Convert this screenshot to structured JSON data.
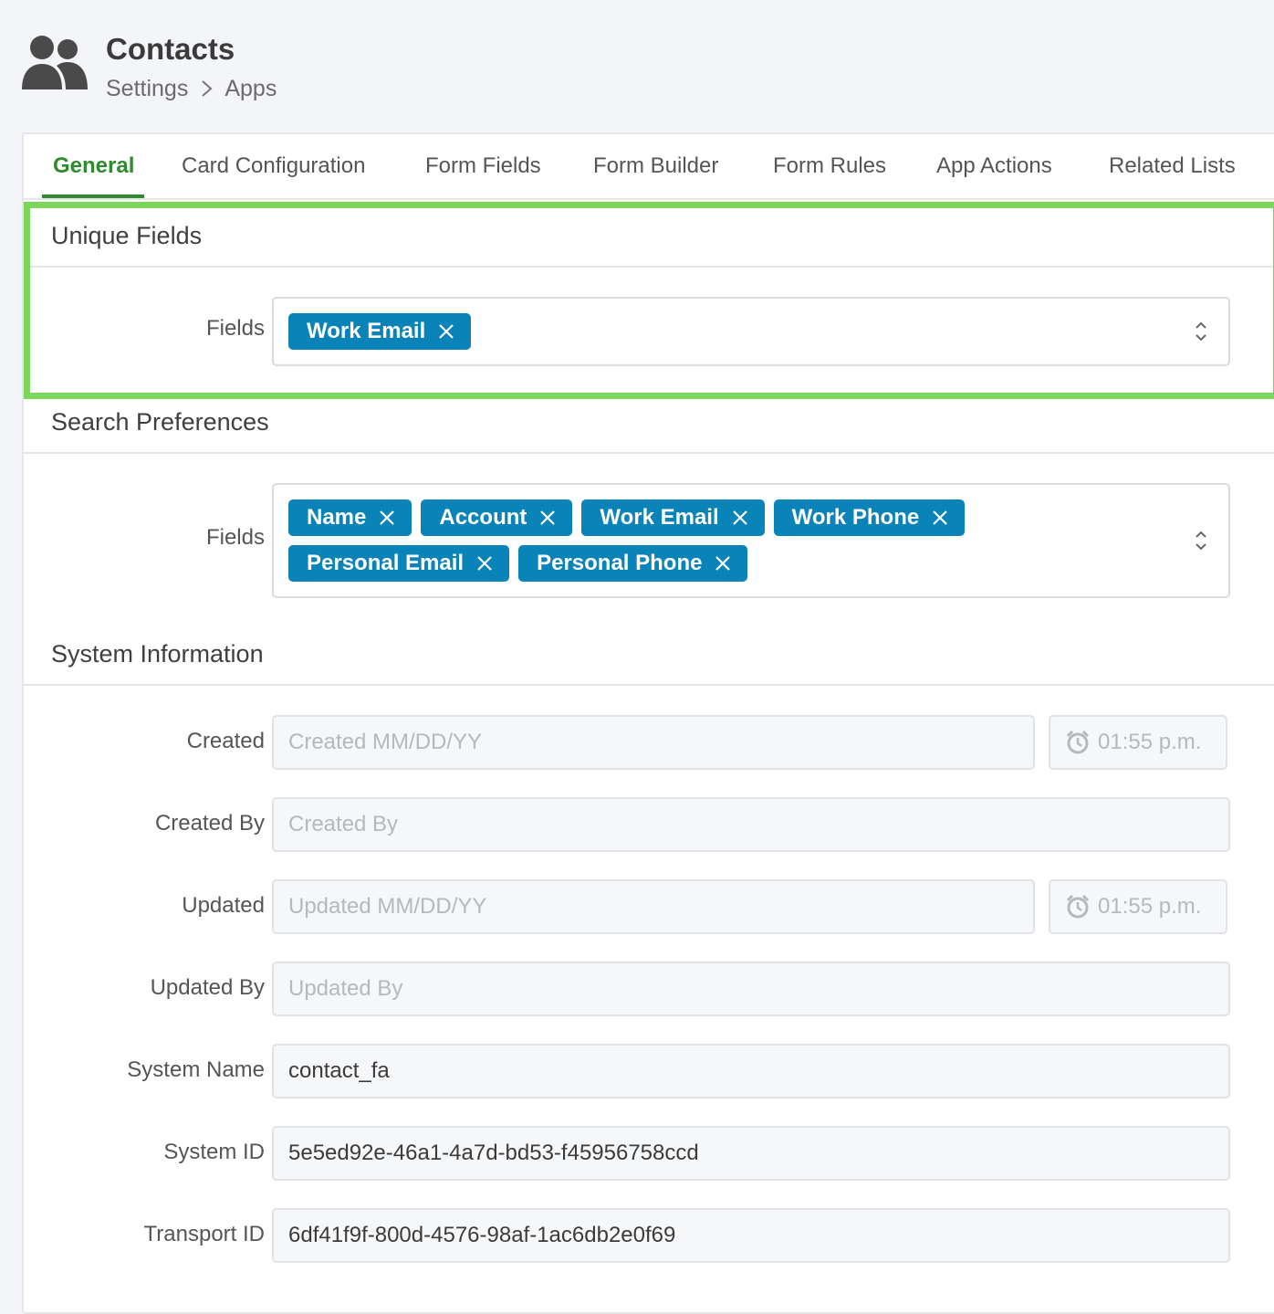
{
  "header": {
    "icon": "contacts-icon",
    "title": "Contacts",
    "breadcrumb": [
      "Settings",
      "Apps"
    ]
  },
  "tabs": [
    {
      "label": "General",
      "active": true
    },
    {
      "label": "Card Configuration"
    },
    {
      "label": "Form Fields"
    },
    {
      "label": "Form Builder"
    },
    {
      "label": "Form Rules"
    },
    {
      "label": "App Actions"
    },
    {
      "label": "Related Lists"
    }
  ],
  "colors": {
    "accent": "#2e8b2e",
    "chip": "#0a84b8",
    "highlight": "#7cd65b"
  },
  "unique_fields": {
    "title": "Unique Fields",
    "label": "Fields",
    "selected": [
      "Work Email"
    ]
  },
  "search_preferences": {
    "title": "Search Preferences",
    "label": "Fields",
    "selected": [
      "Name",
      "Account",
      "Work Email",
      "Work Phone",
      "Personal Email",
      "Personal Phone"
    ]
  },
  "system_information": {
    "title": "System Information",
    "created": {
      "label": "Created",
      "placeholder": "Created MM/DD/YY",
      "time": "01:55 p.m."
    },
    "created_by": {
      "label": "Created By",
      "placeholder": "Created By"
    },
    "updated": {
      "label": "Updated",
      "placeholder": "Updated MM/DD/YY",
      "time": "01:55 p.m."
    },
    "updated_by": {
      "label": "Updated By",
      "placeholder": "Updated By"
    },
    "system_name": {
      "label": "System Name",
      "value": "contact_fa"
    },
    "system_id": {
      "label": "System ID",
      "value": "5e5ed92e-46a1-4a7d-bd53-f45956758ccd"
    },
    "transport_id": {
      "label": "Transport ID",
      "value": "6df41f9f-800d-4576-98af-1ac6db2e0f69"
    }
  }
}
